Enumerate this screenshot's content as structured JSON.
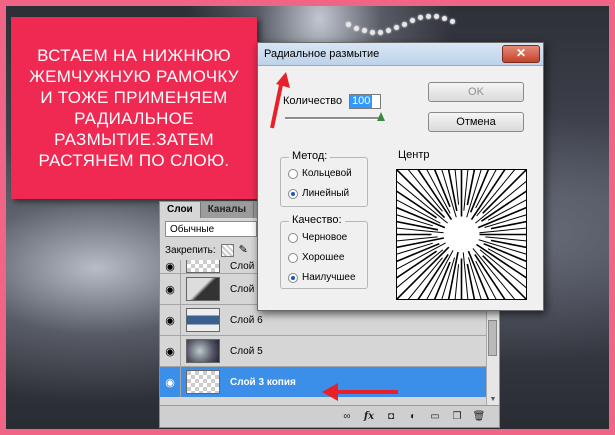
{
  "annotation": {
    "text": "ВСТАЕМ НА НИЖНЮЮ ЖЕМЧУЖНУЮ РАМОЧКУ И ТОЖЕ ПРИМЕНЯЕМ РАДИАЛЬНОЕ РАЗМЫТИЕ.ЗАТЕМ РАСТЯНЕМ ПО СЛОЮ.",
    "background_color": "#ef2952",
    "frame_color": "#f06485"
  },
  "layers_panel": {
    "tabs": [
      "Слои",
      "Каналы"
    ],
    "active_tab": "Слои",
    "blend_mode": "Обычные",
    "lock_label": "Закрепить:",
    "layers": [
      {
        "name": "Слой",
        "thumb": "checker",
        "partial": true
      },
      {
        "name": "Слой",
        "thumb": "dark"
      },
      {
        "name": "Слой 6",
        "thumb": "blue"
      },
      {
        "name": "Слой 5",
        "thumb": "gray"
      },
      {
        "name": "Слой 3 копия",
        "thumb": "checker",
        "selected": true
      }
    ],
    "footer_icons": [
      "link-icon",
      "fx-icon",
      "mask-icon",
      "adjustment-icon",
      "folder-icon",
      "new-layer-icon",
      "trash-icon"
    ],
    "selection_color": "#3b8fe8"
  },
  "dialog": {
    "title": "Радиальное размытие",
    "close_glyph": "✕",
    "amount_label": "Количество",
    "amount_value": "100",
    "amount_fraction": 1.0,
    "ok_label": "OK",
    "cancel_label": "Отмена",
    "method": {
      "title": "Метод:",
      "options": [
        "Кольцевой",
        "Линейный"
      ],
      "selected": "Линейный"
    },
    "quality": {
      "title": "Качество:",
      "options": [
        "Черновое",
        "Хорошее",
        "Наилучшее"
      ],
      "selected": "Наилучшее"
    },
    "center_label": "Центр"
  },
  "arrow_color": "#e8202a"
}
